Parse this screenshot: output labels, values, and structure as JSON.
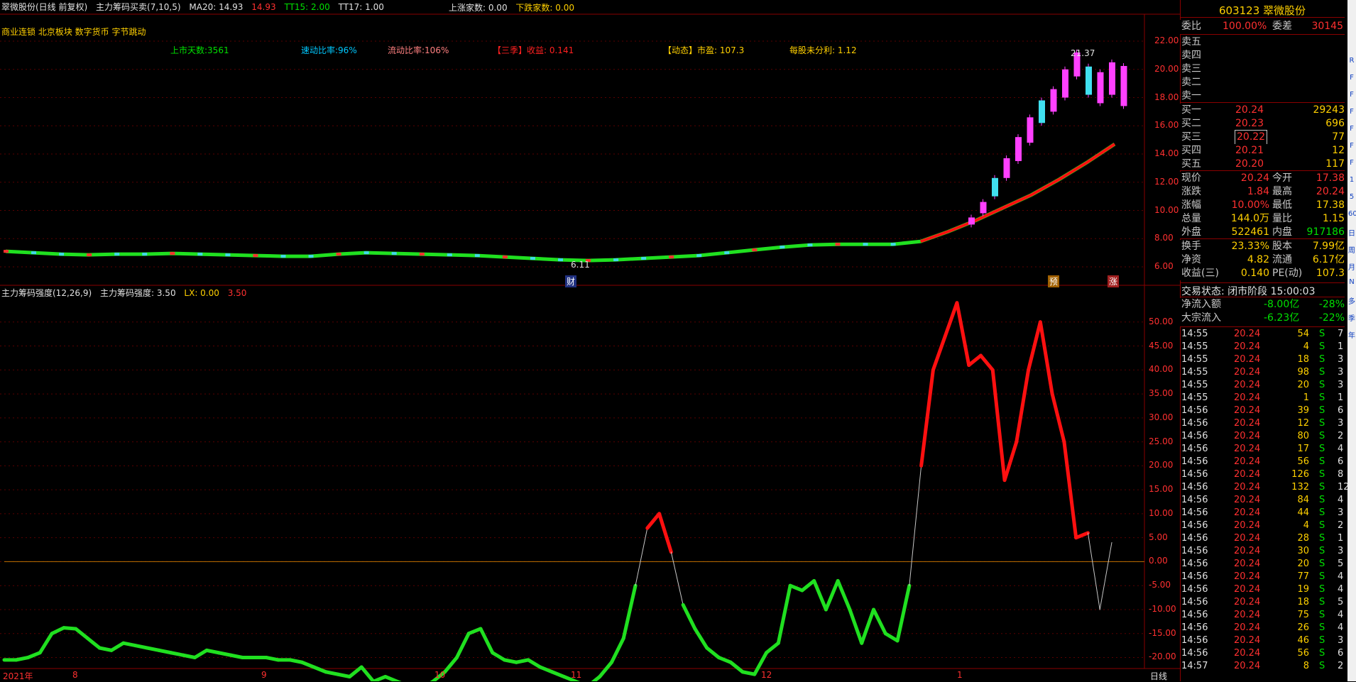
{
  "header": {
    "stock_name": "翠微股份(日线 前复权)",
    "indicator": "主力筹码买卖(7,10,5)",
    "ma20": "MA20: 14.93",
    "ma_val2": "14.93",
    "tt15": "TT15: 2.00",
    "tt17": "TT17: 1.00",
    "up_count": "上涨家数: 0.00",
    "down_count": "下跌家数: 0.00"
  },
  "concepts": "商业连锁 北京板块 数字货币 字节跳动",
  "info_line": {
    "days": "上市天数:3561",
    "quick_ratio": "速动比率:96%",
    "current_ratio": "流动比率:106%",
    "q3": "【三季】收益: 0.141",
    "pe": "【动态】市盈: 107.3",
    "undistributed": "每股未分利: 1.12"
  },
  "main_chart": {
    "y_ticks": [
      "22.00",
      "20.00",
      "18.00",
      "16.00",
      "14.00",
      "12.00",
      "10.00",
      "8.00",
      "6.00"
    ],
    "high_label": "21.37",
    "low_label": "6.11",
    "markers": [
      "财",
      "预",
      "涨"
    ]
  },
  "sub_header": {
    "title": "主力筹码强度(12,26,9)",
    "strength": "主力筹码强度: 3.50",
    "lx": "LX: 0.00",
    "val": "3.50"
  },
  "sub_chart": {
    "y_ticks": [
      "50.00",
      "45.00",
      "40.00",
      "35.00",
      "30.00",
      "25.00",
      "20.00",
      "15.00",
      "10.00",
      "5.00",
      "0.00",
      "-5.00",
      "-10.00",
      "-15.00",
      "-20.00"
    ]
  },
  "x_axis": {
    "labels": [
      "2021年",
      "8",
      "9",
      "10",
      "11",
      "12",
      "1"
    ],
    "period": "日线"
  },
  "chart_data": [
    {
      "type": "line",
      "title": "",
      "ylim": [
        6,
        22
      ],
      "series": [
        {
          "name": "MA",
          "values": [
            7.1,
            7.0,
            6.9,
            6.85,
            6.9,
            6.9,
            6.95,
            6.9,
            6.85,
            6.8,
            6.75,
            6.75,
            6.9,
            7.0,
            6.95,
            6.9,
            6.85,
            6.8,
            6.7,
            6.6,
            6.5,
            6.45,
            6.5,
            6.6,
            6.7,
            6.8,
            7.0,
            7.2,
            7.4,
            7.55,
            7.6,
            7.6,
            7.6,
            7.8,
            8.5,
            9.3,
            10.2,
            11.1,
            12.2,
            13.4,
            14.7
          ]
        }
      ]
    },
    {
      "type": "line",
      "title": "",
      "ylim": [
        -22,
        55
      ],
      "series": [
        {
          "name": "主力筹码强度",
          "values": [
            -20.5,
            -20.5,
            -20,
            -19,
            -15,
            -13.8,
            -14,
            -16,
            -18,
            -18.5,
            -17,
            -17.5,
            -18,
            -18.5,
            -19,
            -19.5,
            -20,
            -18.5,
            -19,
            -19.5,
            -20,
            -20,
            -20,
            -20.5,
            -20.5,
            -21,
            -22,
            -23,
            -23.5,
            -24,
            -22,
            -25,
            -24,
            -25,
            -26,
            -26.5,
            -25,
            -23,
            -20,
            -15,
            -14,
            -19,
            -20.5,
            -21,
            -20.5,
            -22,
            -23,
            -24,
            -25,
            -26,
            -24,
            -21,
            -16,
            -5,
            7,
            10,
            2,
            -9,
            -14,
            -18,
            -20,
            -21,
            -23,
            -23.5,
            -19,
            -17,
            -5,
            -6,
            -4,
            -10,
            -4,
            -10,
            -17,
            -10,
            -15,
            -16.5,
            -5,
            20,
            40,
            47,
            54,
            41,
            43,
            40,
            17,
            25,
            40,
            50,
            35,
            25,
            5,
            6,
            -10,
            4
          ]
        }
      ]
    }
  ],
  "quote": {
    "code_name": "603123 翠微股份",
    "weibi_label": "委比",
    "weibi": "100.00%",
    "weicha_label": "委差",
    "weicha": "30145",
    "sells": [
      "卖五",
      "卖四",
      "卖三",
      "卖二",
      "卖一"
    ],
    "buys": [
      {
        "label": "买一",
        "price": "20.24",
        "vol": "29243"
      },
      {
        "label": "买二",
        "price": "20.23",
        "vol": "696"
      },
      {
        "label": "买三",
        "price": "20.22",
        "vol": "77"
      },
      {
        "label": "买四",
        "price": "20.21",
        "vol": "12"
      },
      {
        "label": "买五",
        "price": "20.20",
        "vol": "117"
      }
    ],
    "stats": [
      [
        "现价",
        "20.24",
        "今开",
        "17.38"
      ],
      [
        "涨跌",
        "1.84",
        "最高",
        "20.24"
      ],
      [
        "涨幅",
        "10.00%",
        "最低",
        "17.38"
      ],
      [
        "总量",
        "144.0万",
        "量比",
        "1.15"
      ],
      [
        "外盘",
        "522461",
        "内盘",
        "917186"
      ]
    ],
    "fund": [
      [
        "换手",
        "23.33%",
        "股本",
        "7.99亿"
      ],
      [
        "净资",
        "4.82",
        "流通",
        "6.17亿"
      ],
      [
        "收益(三)",
        "0.140",
        "PE(动)",
        "107.3"
      ]
    ],
    "status": "交易状态: 闭市阶段 15:00:03",
    "netflow_label": "净流入额",
    "netflow": "-8.00亿",
    "netflow_pct": "-28%",
    "block_label": "大宗流入",
    "block": "-6.23亿",
    "block_pct": "-22%"
  },
  "ticks": [
    [
      "14:55",
      "20.24",
      "54",
      "S",
      "7"
    ],
    [
      "14:55",
      "20.24",
      "4",
      "S",
      "1"
    ],
    [
      "14:55",
      "20.24",
      "18",
      "S",
      "3"
    ],
    [
      "14:55",
      "20.24",
      "98",
      "S",
      "3"
    ],
    [
      "14:55",
      "20.24",
      "20",
      "S",
      "3"
    ],
    [
      "14:55",
      "20.24",
      "1",
      "S",
      "1"
    ],
    [
      "14:56",
      "20.24",
      "39",
      "S",
      "6"
    ],
    [
      "14:56",
      "20.24",
      "12",
      "S",
      "3"
    ],
    [
      "14:56",
      "20.24",
      "80",
      "S",
      "2"
    ],
    [
      "14:56",
      "20.24",
      "17",
      "S",
      "4"
    ],
    [
      "14:56",
      "20.24",
      "56",
      "S",
      "6"
    ],
    [
      "14:56",
      "20.24",
      "126",
      "S",
      "8"
    ],
    [
      "14:56",
      "20.24",
      "132",
      "S",
      "12"
    ],
    [
      "14:56",
      "20.24",
      "84",
      "S",
      "4"
    ],
    [
      "14:56",
      "20.24",
      "44",
      "S",
      "3"
    ],
    [
      "14:56",
      "20.24",
      "4",
      "S",
      "2"
    ],
    [
      "14:56",
      "20.24",
      "28",
      "S",
      "1"
    ],
    [
      "14:56",
      "20.24",
      "30",
      "S",
      "3"
    ],
    [
      "14:56",
      "20.24",
      "20",
      "S",
      "5"
    ],
    [
      "14:56",
      "20.24",
      "77",
      "S",
      "4"
    ],
    [
      "14:56",
      "20.24",
      "19",
      "S",
      "4"
    ],
    [
      "14:56",
      "20.24",
      "18",
      "S",
      "5"
    ],
    [
      "14:56",
      "20.24",
      "75",
      "S",
      "4"
    ],
    [
      "14:56",
      "20.24",
      "26",
      "S",
      "4"
    ],
    [
      "14:56",
      "20.24",
      "46",
      "S",
      "3"
    ],
    [
      "14:56",
      "20.24",
      "56",
      "S",
      "6"
    ],
    [
      "14:57",
      "20.24",
      "8",
      "S",
      "2"
    ]
  ],
  "edge_tabs": [
    "R",
    "F",
    "F",
    "F",
    "F",
    "F",
    "F",
    "1",
    "5",
    "60",
    "日",
    "周",
    "月",
    "N",
    "多",
    "季",
    "年"
  ]
}
